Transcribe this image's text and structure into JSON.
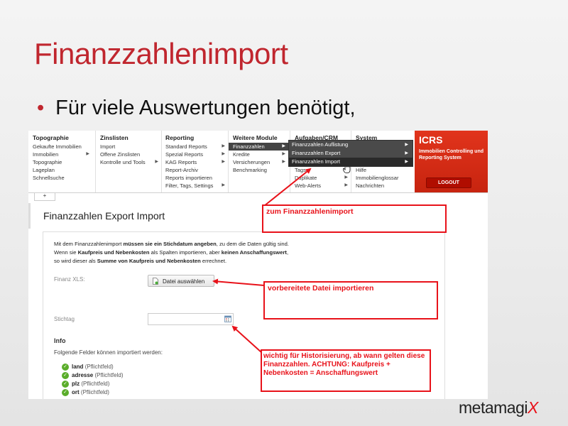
{
  "slide": {
    "title": "Finanzzahlenimport",
    "bullet": "Für viele Auswertungen benötigt,"
  },
  "menu": {
    "columns": [
      {
        "header": "Topographie",
        "items": [
          "Gekaufte Immobilien",
          "Immobilien",
          "Topographie",
          "Lageplan",
          "Schnellsuche"
        ]
      },
      {
        "header": "Zinslisten",
        "items": [
          "Import",
          "Offene Zinslisten",
          "Kontrolle und Tools"
        ]
      },
      {
        "header": "Reporting",
        "items": [
          "Standard Reports",
          "Spezial Reports",
          "KAG Reports",
          "Report-Archiv",
          "Reports importieren",
          "Filter, Tags, Settings"
        ]
      },
      {
        "header": "Weitere Module",
        "items": [
          "Finanzzahlen",
          "Kredite",
          "Versicherungen",
          "Benchmarking"
        ]
      },
      {
        "header": "Aufgaben/CRM",
        "items": [
          "Tags",
          "Duplikate",
          "Web-Alerts"
        ]
      },
      {
        "header": "System",
        "items": [
          "Hilfe",
          "Immobilienglossar",
          "Nachrichten"
        ]
      }
    ],
    "submenu": [
      "Finanzzahlen Auflistung",
      "Finanzzahlen Export",
      "Finanzzahlen Import"
    ]
  },
  "icrs": {
    "title": "ICRS",
    "subtitle": "Immobilien Controlling und Reporting System",
    "logout": "LOGOUT"
  },
  "tab_label": "+",
  "page": {
    "heading": "Finanzzahlen Export Import",
    "intro1_a": "Mit dem Finanzzahlenimport ",
    "intro1_b": "müssen sie ein Stichdatum angeben",
    "intro1_c": ", zu dem die Daten gültig sind.",
    "intro2_a": "Wenn sie ",
    "intro2_b": "Kaufpreis und Nebenkosten",
    "intro2_c": " als Spalten importieren, aber ",
    "intro2_d": "keinen Anschaffungswert",
    "intro2_e": ",",
    "intro3_a": "so wird dieser als ",
    "intro3_b": "Summe von Kaufpreis und Nebenkosten",
    "intro3_c": " errechnet.",
    "file_label": "Finanz XLS:",
    "file_button": "Datei auswählen",
    "date_label": "Stichtag",
    "date_value": "",
    "info_heading": "Info",
    "fields_intro": "Folgende Felder können importiert werden:",
    "fields": [
      {
        "name": "land",
        "note": "(Pflichtfeld)"
      },
      {
        "name": "adresse",
        "note": "(Pflichtfeld)"
      },
      {
        "name": "plz",
        "note": "(Pflichtfeld)"
      },
      {
        "name": "ort",
        "note": "(Pflichtfeld)"
      }
    ]
  },
  "annotations": [
    "zum Finanzzahlenimport",
    "vorbereitete Datei importieren",
    "wichtig für Historisierung, ab wann gelten diese Finanzzahlen. ACHTUNG: Kaufpreis + Nebenkosten = Anschaffungswert"
  ],
  "brand": {
    "name": "metamagi",
    "suffix": "X"
  },
  "colors": {
    "title": "#c0262e",
    "accent": "#e8121a",
    "icrs": "#d42a14"
  }
}
